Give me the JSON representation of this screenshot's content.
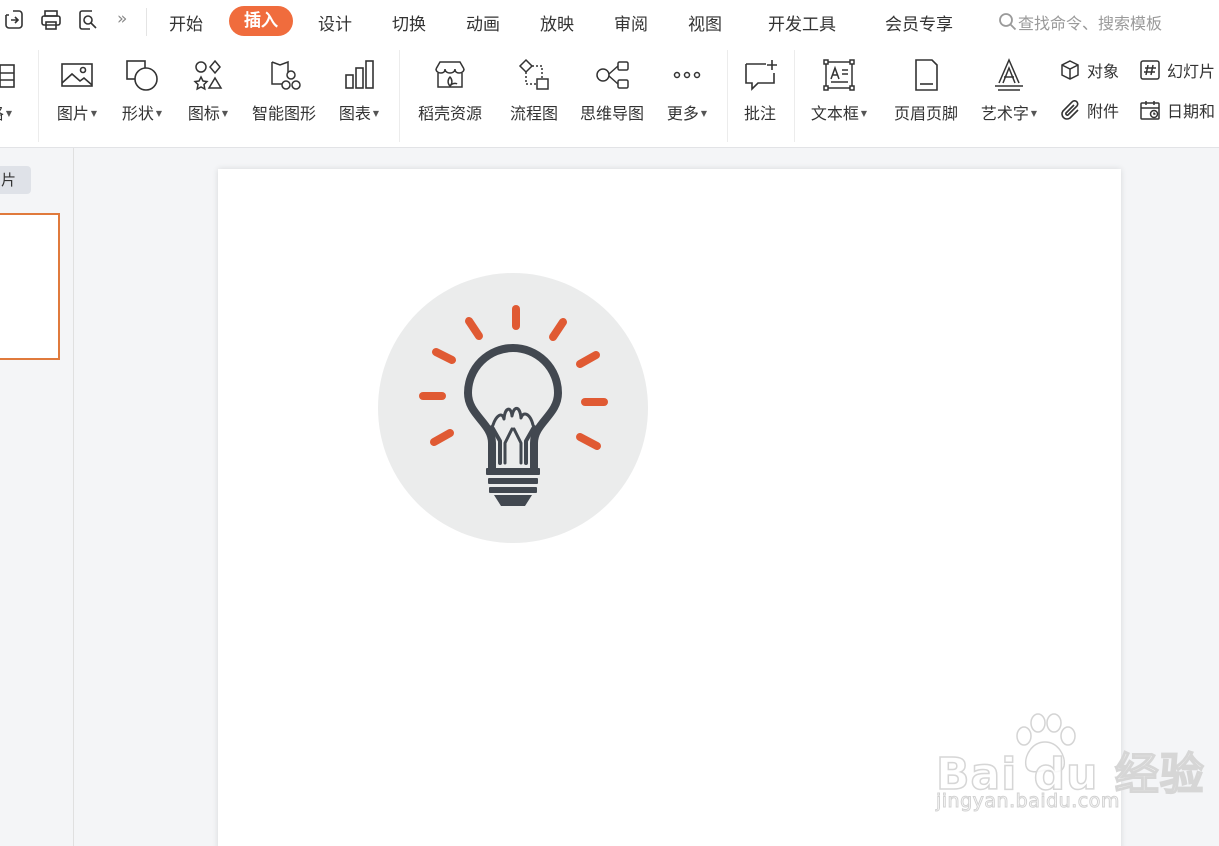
{
  "topbar": {
    "more_glyph": "»",
    "tabs": [
      {
        "label": "开始"
      },
      {
        "label": "插入"
      },
      {
        "label": "设计"
      },
      {
        "label": "切换"
      },
      {
        "label": "动画"
      },
      {
        "label": "放映"
      },
      {
        "label": "审阅"
      },
      {
        "label": "视图"
      },
      {
        "label": "开发工具"
      },
      {
        "label": "会员专享"
      }
    ],
    "active_tab": "插入",
    "search_placeholder": "查找命令、搜索模板"
  },
  "ribbon": {
    "tools": [
      {
        "label": "格",
        "icon": "table-icon"
      },
      {
        "label": "图片",
        "icon": "picture-icon"
      },
      {
        "label": "形状",
        "icon": "shape-icon"
      },
      {
        "label": "图标",
        "icon": "icons-icon"
      },
      {
        "label": "智能图形",
        "icon": "smartart-icon"
      },
      {
        "label": "图表",
        "icon": "chart-icon"
      },
      {
        "label": "稻壳资源",
        "icon": "docer-store-icon"
      },
      {
        "label": "流程图",
        "icon": "flowchart-icon"
      },
      {
        "label": "思维导图",
        "icon": "mindmap-icon"
      },
      {
        "label": "更多",
        "icon": "more-dots-icon"
      },
      {
        "label": "批注",
        "icon": "comment-icon"
      },
      {
        "label": "文本框",
        "icon": "textbox-icon"
      },
      {
        "label": "页眉页脚",
        "icon": "header-footer-icon"
      },
      {
        "label": "艺术字",
        "icon": "wordart-icon"
      }
    ],
    "small_tools": [
      {
        "label": "对象",
        "icon": "object-icon"
      },
      {
        "label": "幻灯片",
        "icon": "slide-number-icon"
      },
      {
        "label": "附件",
        "icon": "paperclip-icon"
      },
      {
        "label": "日期和",
        "icon": "calendar-icon"
      }
    ]
  },
  "left_pane": {
    "tab_label": "片"
  },
  "slide": {
    "image": "lightbulb-icon",
    "colors": {
      "circle": "#ebecec",
      "bulb": "#424850",
      "rays": "#e05a33"
    }
  },
  "watermark": {
    "main": "Bai  du 经验",
    "sub": "jingyan.baidu.com"
  },
  "colors": {
    "accent": "#f06c3d",
    "thumb_border": "#e07a3c"
  }
}
